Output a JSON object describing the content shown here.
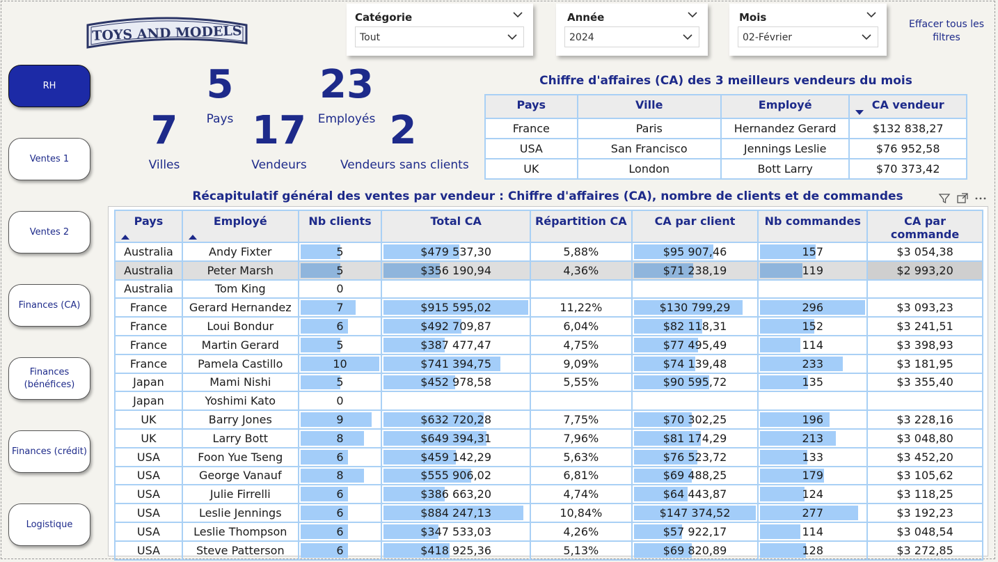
{
  "logo": {
    "text": "TOYS AND MODELS"
  },
  "slicers": [
    {
      "title": "Catégorie",
      "value": "Tout"
    },
    {
      "title": "Année",
      "value": "2024"
    },
    {
      "title": "Mois",
      "value": "02-Février"
    }
  ],
  "clear_filters": "Effacer tous les filtres",
  "nav": [
    "RH",
    "Ventes 1",
    "Ventes 2",
    "Finances (CA)",
    "Finances (bénéfices)",
    "Finances (crédit)",
    "Logistique"
  ],
  "kpis": {
    "pays": {
      "value": "5",
      "label": "Pays"
    },
    "employes": {
      "value": "23",
      "label": "Employés"
    },
    "villes": {
      "value": "7",
      "label": "Villes"
    },
    "vendeurs": {
      "value": "17",
      "label": "Vendeurs"
    },
    "sans_clients": {
      "value": "2",
      "label": "Vendeurs sans clients"
    }
  },
  "top3": {
    "title": "Chiffre d'affaires (CA) des 3 meilleurs vendeurs du mois",
    "headers": [
      "Pays",
      "Ville",
      "Employé",
      "CA vendeur"
    ],
    "rows": [
      [
        "France",
        "Paris",
        "Hernandez Gerard",
        "$132 838,27"
      ],
      [
        "USA",
        "San Francisco",
        "Jennings Leslie",
        "$76 952,58"
      ],
      [
        "UK",
        "London",
        "Bott Larry",
        "$70 373,42"
      ]
    ]
  },
  "summary": {
    "title": "Récapitulatif général des ventes par vendeur : Chiffre d'affaires (CA), nombre de clients et de commandes",
    "headers": [
      "Pays",
      "Employé",
      "Nb clients",
      "Total CA",
      "Répartition CA",
      "CA par client",
      "Nb commandes",
      "CA par commande"
    ],
    "rows": [
      {
        "pays": "Australia",
        "employe": "Andy Fixter",
        "nb_clients": "5",
        "total_ca": "$479 537,30",
        "repartition": "5,88%",
        "ca_client": "$95 907,46",
        "nb_commandes": "157",
        "ca_commande": "$3 054,38",
        "clients_n": 5,
        "ca_n": 479537.3,
        "cac_n": 95907.46,
        "cmd_n": 157
      },
      {
        "pays": "Australia",
        "employe": "Peter Marsh",
        "nb_clients": "5",
        "total_ca": "$356 190,94",
        "repartition": "4,36%",
        "ca_client": "$71 238,19",
        "nb_commandes": "119",
        "ca_commande": "$2 993,20",
        "clients_n": 5,
        "ca_n": 356190.94,
        "cac_n": 71238.19,
        "cmd_n": 119
      },
      {
        "pays": "Australia",
        "employe": "Tom King",
        "nb_clients": "0",
        "total_ca": "",
        "repartition": "",
        "ca_client": "",
        "nb_commandes": "",
        "ca_commande": "",
        "clients_n": 0,
        "ca_n": 0,
        "cac_n": 0,
        "cmd_n": 0
      },
      {
        "pays": "France",
        "employe": "Gerard Hernandez",
        "nb_clients": "7",
        "total_ca": "$915 595,02",
        "repartition": "11,22%",
        "ca_client": "$130 799,29",
        "nb_commandes": "296",
        "ca_commande": "$3 093,23",
        "clients_n": 7,
        "ca_n": 915595.02,
        "cac_n": 130799.29,
        "cmd_n": 296
      },
      {
        "pays": "France",
        "employe": "Loui Bondur",
        "nb_clients": "6",
        "total_ca": "$492 709,87",
        "repartition": "6,04%",
        "ca_client": "$82 118,31",
        "nb_commandes": "152",
        "ca_commande": "$3 241,51",
        "clients_n": 6,
        "ca_n": 492709.87,
        "cac_n": 82118.31,
        "cmd_n": 152
      },
      {
        "pays": "France",
        "employe": "Martin Gerard",
        "nb_clients": "5",
        "total_ca": "$387 477,47",
        "repartition": "4,75%",
        "ca_client": "$77 495,49",
        "nb_commandes": "114",
        "ca_commande": "$3 398,93",
        "clients_n": 5,
        "ca_n": 387477.47,
        "cac_n": 77495.49,
        "cmd_n": 114
      },
      {
        "pays": "France",
        "employe": "Pamela Castillo",
        "nb_clients": "10",
        "total_ca": "$741 394,75",
        "repartition": "9,09%",
        "ca_client": "$74 139,48",
        "nb_commandes": "233",
        "ca_commande": "$3 181,95",
        "clients_n": 10,
        "ca_n": 741394.75,
        "cac_n": 74139.48,
        "cmd_n": 233
      },
      {
        "pays": "Japan",
        "employe": "Mami Nishi",
        "nb_clients": "5",
        "total_ca": "$452 978,58",
        "repartition": "5,55%",
        "ca_client": "$90 595,72",
        "nb_commandes": "135",
        "ca_commande": "$3 355,40",
        "clients_n": 5,
        "ca_n": 452978.58,
        "cac_n": 90595.72,
        "cmd_n": 135
      },
      {
        "pays": "Japan",
        "employe": "Yoshimi Kato",
        "nb_clients": "0",
        "total_ca": "",
        "repartition": "",
        "ca_client": "",
        "nb_commandes": "",
        "ca_commande": "",
        "clients_n": 0,
        "ca_n": 0,
        "cac_n": 0,
        "cmd_n": 0
      },
      {
        "pays": "UK",
        "employe": "Barry Jones",
        "nb_clients": "9",
        "total_ca": "$632 720,28",
        "repartition": "7,75%",
        "ca_client": "$70 302,25",
        "nb_commandes": "196",
        "ca_commande": "$3 228,16",
        "clients_n": 9,
        "ca_n": 632720.28,
        "cac_n": 70302.25,
        "cmd_n": 196
      },
      {
        "pays": "UK",
        "employe": "Larry Bott",
        "nb_clients": "8",
        "total_ca": "$649 394,31",
        "repartition": "7,96%",
        "ca_client": "$81 174,29",
        "nb_commandes": "213",
        "ca_commande": "$3 048,80",
        "clients_n": 8,
        "ca_n": 649394.31,
        "cac_n": 81174.29,
        "cmd_n": 213
      },
      {
        "pays": "USA",
        "employe": "Foon Yue Tseng",
        "nb_clients": "6",
        "total_ca": "$459 142,29",
        "repartition": "5,63%",
        "ca_client": "$76 523,72",
        "nb_commandes": "133",
        "ca_commande": "$3 452,20",
        "clients_n": 6,
        "ca_n": 459142.29,
        "cac_n": 76523.72,
        "cmd_n": 133
      },
      {
        "pays": "USA",
        "employe": "George Vanauf",
        "nb_clients": "8",
        "total_ca": "$555 906,02",
        "repartition": "6,81%",
        "ca_client": "$69 488,25",
        "nb_commandes": "179",
        "ca_commande": "$3 105,62",
        "clients_n": 8,
        "ca_n": 555906.02,
        "cac_n": 69488.25,
        "cmd_n": 179
      },
      {
        "pays": "USA",
        "employe": "Julie Firrelli",
        "nb_clients": "6",
        "total_ca": "$386 663,20",
        "repartition": "4,74%",
        "ca_client": "$64 443,87",
        "nb_commandes": "124",
        "ca_commande": "$3 118,25",
        "clients_n": 6,
        "ca_n": 386663.2,
        "cac_n": 64443.87,
        "cmd_n": 124
      },
      {
        "pays": "USA",
        "employe": "Leslie Jennings",
        "nb_clients": "6",
        "total_ca": "$884 247,13",
        "repartition": "10,84%",
        "ca_client": "$147 374,52",
        "nb_commandes": "277",
        "ca_commande": "$3 192,23",
        "clients_n": 6,
        "ca_n": 884247.13,
        "cac_n": 147374.52,
        "cmd_n": 277
      },
      {
        "pays": "USA",
        "employe": "Leslie Thompson",
        "nb_clients": "6",
        "total_ca": "$347 533,03",
        "repartition": "4,26%",
        "ca_client": "$57 922,17",
        "nb_commandes": "114",
        "ca_commande": "$3 048,54",
        "clients_n": 6,
        "ca_n": 347533.03,
        "cac_n": 57922.17,
        "cmd_n": 114
      },
      {
        "pays": "USA",
        "employe": "Steve Patterson",
        "nb_clients": "6",
        "total_ca": "$418 925,36",
        "repartition": "5,13%",
        "ca_client": "$69 820,89",
        "nb_commandes": "128",
        "ca_commande": "$3 272,85",
        "clients_n": 6,
        "ca_n": 418925.36,
        "cac_n": 69820.89,
        "cmd_n": 128
      }
    ]
  },
  "colors": {
    "accent": "#1d2a8a",
    "bar": "#a3cdf9",
    "grid": "#a9d0f5",
    "nav_active": "#1c2aa6"
  }
}
